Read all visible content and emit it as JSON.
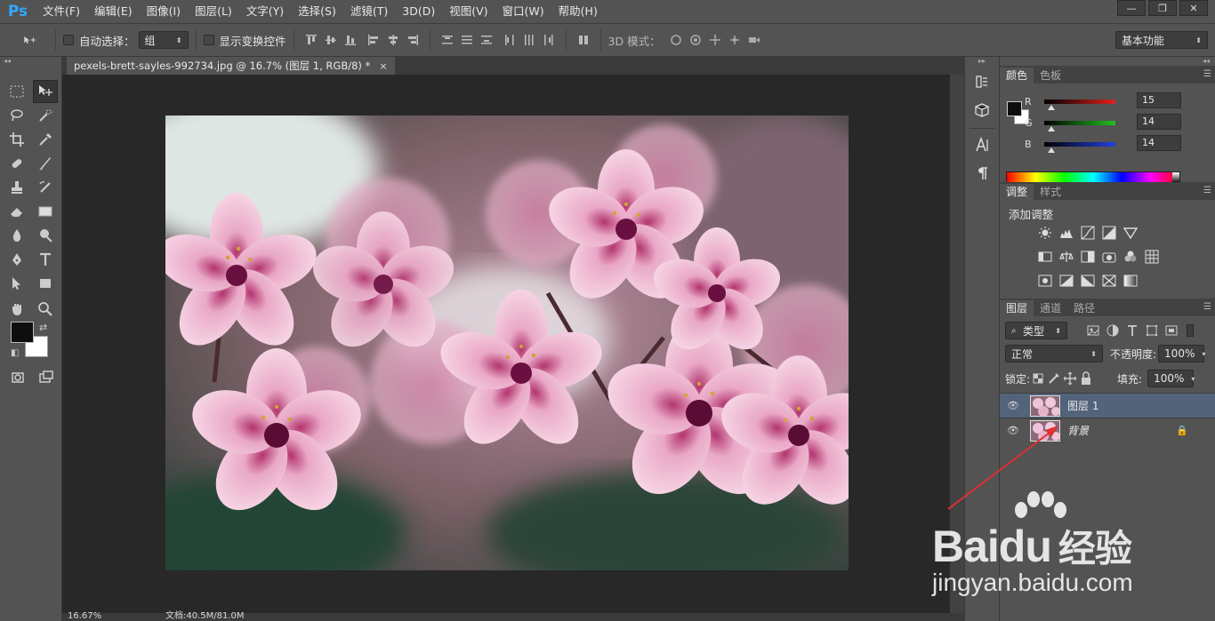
{
  "app": {
    "logo": "Ps",
    "menu": [
      "文件(F)",
      "编辑(E)",
      "图像(I)",
      "图层(L)",
      "文字(Y)",
      "选择(S)",
      "滤镜(T)",
      "3D(D)",
      "视图(V)",
      "窗口(W)",
      "帮助(H)"
    ],
    "window_controls": {
      "minimize": "—",
      "restore": "❐",
      "close": "✕"
    }
  },
  "options": {
    "auto_select_label": "自动选择：",
    "auto_select_value": "组",
    "show_transform_label": "显示变换控件",
    "mode_3d_label": "3D 模式：",
    "workspace": "基本功能"
  },
  "document": {
    "tab_title": "pexels-brett-sayles-992734.jpg @ 16.7% (图层 1, RGB/8) *",
    "tab_close": "×",
    "zoom": "16.67%",
    "doc_info": "文档:40.5M/81.0M"
  },
  "color_panel": {
    "tabs": [
      "颜色",
      "色板"
    ],
    "channels": [
      {
        "label": "R",
        "value": "15",
        "gradient": "#e02020"
      },
      {
        "label": "G",
        "value": "14",
        "gradient": "#20c020"
      },
      {
        "label": "B",
        "value": "14",
        "gradient": "#2040e0"
      }
    ],
    "foreground": "#0f0e0e",
    "background": "#ffffff"
  },
  "adjust_panel": {
    "tabs": [
      "调整",
      "样式"
    ],
    "title": "添加调整"
  },
  "layers_panel": {
    "tabs": [
      "图层",
      "通道",
      "路径"
    ],
    "kind_filter": "类型",
    "blend_mode": "正常",
    "opacity_label": "不透明度:",
    "opacity_value": "100%",
    "lock_label": "锁定:",
    "fill_label": "填充:",
    "fill_value": "100%",
    "layers": [
      {
        "name": "图层 1",
        "selected": true,
        "locked": false
      },
      {
        "name": "背景",
        "selected": false,
        "locked": true
      }
    ]
  },
  "watermark": {
    "brand_latin": "Baidu",
    "brand_cn": "经验",
    "url": "jingyan.baidu.com"
  },
  "colors": {
    "ui_panel": "#535353",
    "canvas_bg": "#282828",
    "accent_logo": "#31a8ff",
    "selection": "#52637a",
    "annotation_arrow": "#e03030"
  }
}
